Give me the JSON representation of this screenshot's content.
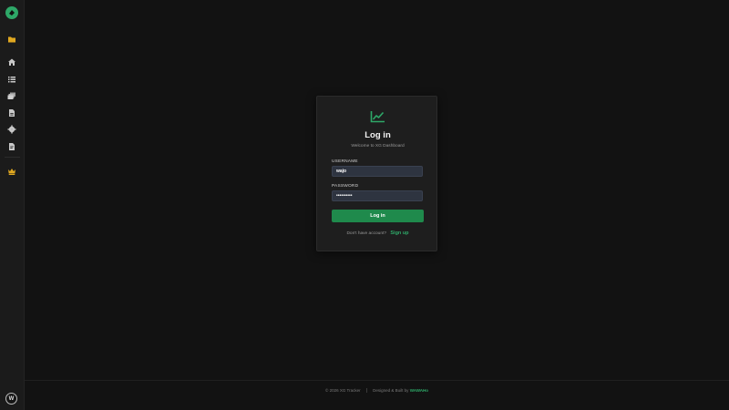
{
  "colors": {
    "accent": "#2ea868",
    "button": "#1f8a4c",
    "background": "#121212",
    "card": "#1e1e1e",
    "input": "#2e3440",
    "crown": "#e0a820",
    "folder": "#e0a820"
  },
  "sidebar": {
    "logo_icon": "app-logo-icon",
    "items": [
      {
        "icon": "folder-icon"
      },
      {
        "icon": "home-icon"
      },
      {
        "icon": "list-icon"
      },
      {
        "icon": "stack-icon"
      },
      {
        "icon": "document-icon"
      },
      {
        "icon": "settings-icon"
      },
      {
        "icon": "report-icon"
      },
      {
        "icon": "crown-icon"
      }
    ],
    "avatar_initial": "W"
  },
  "login": {
    "icon": "chart-line-icon",
    "title": "Log in",
    "subtitle": "Welcome to XG Dashboard",
    "username_label": "USERNAME",
    "username_value": "wajo",
    "password_label": "PASSWORD",
    "password_value": "••••••••••",
    "submit_label": "Log in",
    "signup_prompt": "Don't have account?",
    "signup_link": "Sign up"
  },
  "footer": {
    "copyright": "© 2026 XG Tracker",
    "credit": "Designed & Built by",
    "brand": "WAWAHo"
  }
}
